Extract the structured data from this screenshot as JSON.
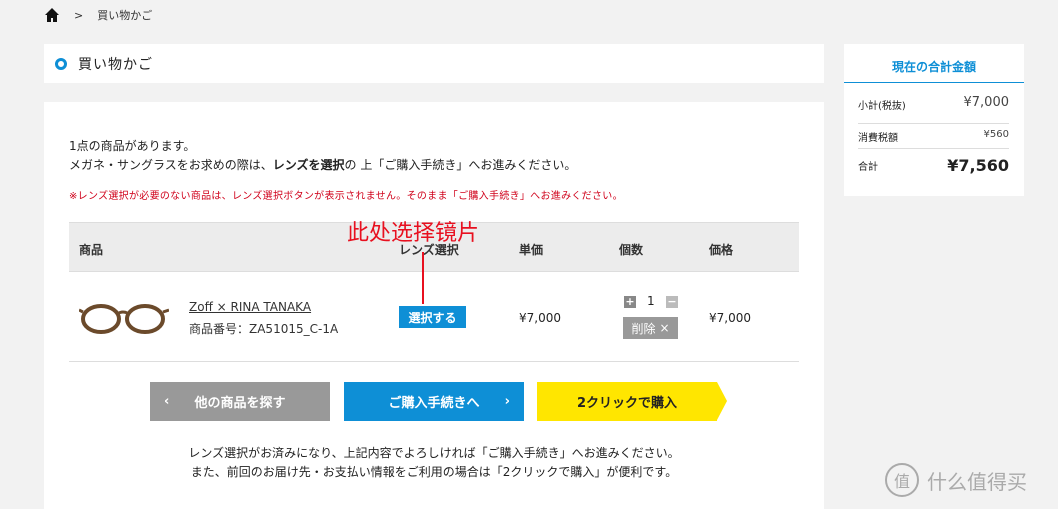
{
  "breadcrumb": {
    "separator": ">",
    "current": "買い物かご"
  },
  "page_title": "買い物かご",
  "intro": {
    "line1": "1点の商品があります。",
    "line2_pre": "メガネ・サングラスをお求めの際は、",
    "line2_bold": "レンズを選択",
    "line2_post": "の 上「ご購入手続き」へお進みください。",
    "warning": "※レンズ選択が必要のない商品は、レンズ選択ボタンが表示されません。そのまま「ご購入手続き」へお進みください。"
  },
  "table": {
    "headers": {
      "product": "商品",
      "lens": "レンズ選択",
      "unit_price": "単価",
      "qty": "個数",
      "price": "価格"
    },
    "row": {
      "name": "Zoff × RINA TANAKA",
      "code": "商品番号：ZA51015_C-1A",
      "lens_button": "選択する",
      "unit_price": "¥7,000",
      "qty": "1",
      "qty_plus": "+",
      "qty_minus": "−",
      "delete": "削除",
      "delete_x": "×",
      "price": "¥7,000"
    }
  },
  "annotation": "此处选择镜片",
  "buttons": {
    "back": "他の商品を探す",
    "back_arrow": "‹",
    "checkout": "ご購入手続きへ",
    "checkout_arrow": "›",
    "two_click": "2クリックで購入"
  },
  "footer": {
    "line1": "レンズ選択がお済みになり、上記内容でよろしければ「ご購入手続き」へお進みください。",
    "line2": "また、前回のお届け先・お支払い情報をご利用の場合は「2クリックで購入」が便利です。"
  },
  "summary": {
    "title": "現在の合計金額",
    "subtotal_label": "小計(税抜)",
    "subtotal": "¥7,000",
    "tax_label": "消費税額",
    "tax": "¥560",
    "total_label": "合計",
    "total": "¥7,560"
  },
  "watermark": {
    "logo": "值",
    "text": "什么值得买"
  },
  "colors": {
    "accent": "#0e8fd6",
    "annotation": "#e8101f",
    "two_click": "#ffe600",
    "warning": "#d0021b"
  }
}
